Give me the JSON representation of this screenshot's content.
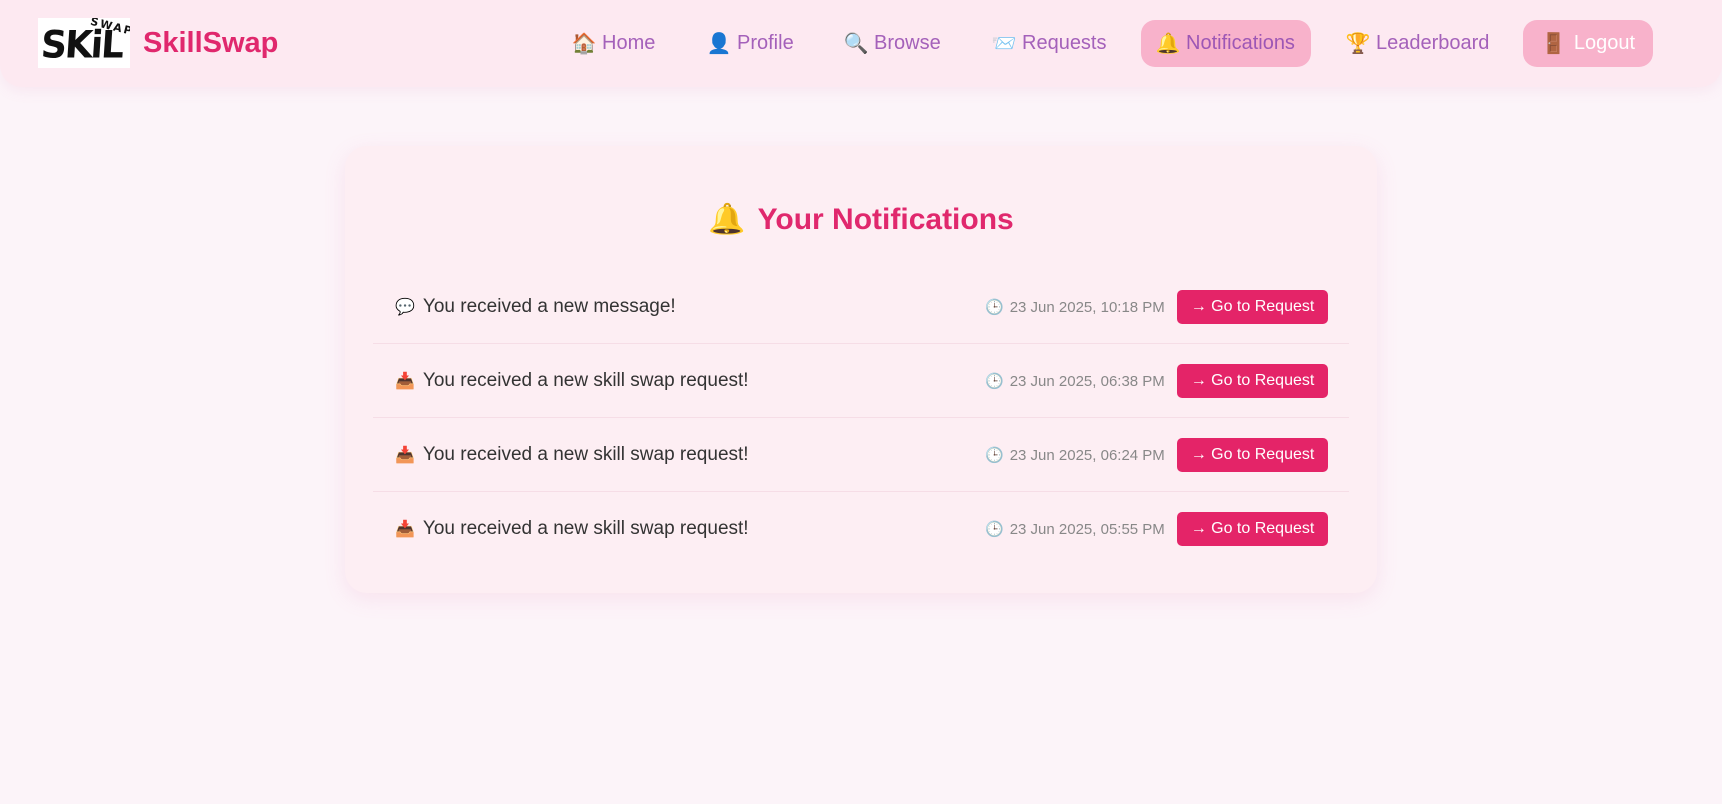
{
  "brand": {
    "logo_text": "SKiL",
    "logo_sub": "SWAP",
    "name": "SkillSwap"
  },
  "nav": {
    "items": [
      {
        "label": "Home",
        "icon": "house-icon",
        "glyph": "🏠"
      },
      {
        "label": "Profile",
        "icon": "user-icon",
        "glyph": "👤"
      },
      {
        "label": "Browse",
        "icon": "search-icon",
        "glyph": "🔍"
      },
      {
        "label": "Requests",
        "icon": "envelope-icon",
        "glyph": "📨"
      },
      {
        "label": "Notifications",
        "icon": "bell-icon",
        "glyph": "🔔",
        "active": true
      },
      {
        "label": "Leaderboard",
        "icon": "trophy-icon",
        "glyph": "🏆"
      }
    ],
    "logout": {
      "label": "Logout",
      "icon": "door-icon",
      "glyph": "🚪"
    }
  },
  "notifications": {
    "title": "Your Notifications",
    "title_icon": "bell-icon",
    "button_label": "→ Go to Request",
    "items": [
      {
        "icon": "speech-bubble-icon",
        "glyph": "💬",
        "text": "You received a new message!",
        "time": "23 Jun 2025, 10:18 PM"
      },
      {
        "icon": "inbox-tray-icon",
        "glyph": "📥",
        "text": "You received a new skill swap request!",
        "time": "23 Jun 2025, 06:38 PM"
      },
      {
        "icon": "inbox-tray-icon",
        "glyph": "📥",
        "text": "You received a new skill swap request!",
        "time": "23 Jun 2025, 06:24 PM"
      },
      {
        "icon": "inbox-tray-icon",
        "glyph": "📥",
        "text": "You received a new skill swap request!",
        "time": "23 Jun 2025, 05:55 PM"
      }
    ]
  },
  "colors": {
    "accent": "#e0286d",
    "nav_text": "#a461ba",
    "active_bg": "#f8b2cb",
    "page_bg": "#fcf4f9",
    "card_bg": "#fdeef3",
    "button_bg": "#e42468"
  }
}
